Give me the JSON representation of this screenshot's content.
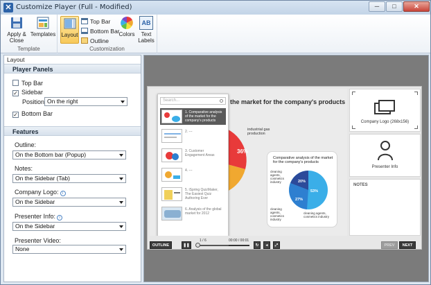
{
  "window": {
    "title": "Customize Player (Full - Modified)",
    "minimize": "─",
    "maximize": "□",
    "close": "✕"
  },
  "ribbon": {
    "template_group": {
      "label": "Template",
      "apply_close": "Apply & Close",
      "templates": "Templates"
    },
    "customization_group": {
      "label": "Customization",
      "layout": "Layout",
      "top_bar": "Top Bar",
      "bottom_bar": "Bottom Bar",
      "outline": "Outline",
      "colors": "Colors",
      "text_labels": "Text Labels",
      "text_labels_icon": "AB"
    }
  },
  "left_panel": {
    "header": "Layout",
    "player_panels": {
      "title": "Player Panels",
      "top_bar": {
        "label": "Top Bar",
        "checked": false
      },
      "sidebar": {
        "label": "Sidebar",
        "checked": true
      },
      "position_label": "Position:",
      "position_value": "On the right",
      "bottom_bar": {
        "label": "Bottom Bar",
        "checked": true
      }
    },
    "features": {
      "title": "Features",
      "outline_label": "Outline:",
      "outline_value": "On the Bottom bar (Popup)",
      "notes_label": "Notes:",
      "notes_value": "On the Sidebar (Tab)",
      "company_logo_label": "Company Logo:",
      "company_logo_value": "On the Sidebar",
      "presenter_info_label": "Presenter Info:",
      "presenter_info_value": "On the Sidebar",
      "presenter_video_label": "Presenter Video:",
      "presenter_video_value": "None"
    },
    "check_mark": "✓"
  },
  "preview": {
    "slide_title": "of the market for the company's products",
    "pie_label": "industrial gas production",
    "pie_pct": "36%",
    "inset_title": "Comparative analysis of the market for the company's products",
    "inset_pcts": [
      "20%",
      "27%",
      "53%"
    ],
    "inset_labels": [
      "cleaning agents, cosmetics industry",
      "cleaning agents, cosmetics industry",
      "cleaning agents, cosmetics industry"
    ],
    "outline": {
      "search_placeholder": "Search...",
      "items": [
        "1. Comparative analysis of the market for the company's products",
        "2. ---",
        "3. Customer Engagement Areas",
        "4. ---",
        "5. iSpring QuizMaker, The Easiest Quiz Authoring Ever",
        "6. Analysis of the global market for 2012"
      ]
    },
    "sidebar": {
      "logo_label": "Company Logo (268x156)",
      "presenter_label": "Presenter Info",
      "notes_label": "NOTES"
    },
    "controls": {
      "outline_btn": "OUTLINE",
      "slide_counter": "1 / 6",
      "time": "00:00 / 00:01",
      "prev": "PREV",
      "next": "NEXT"
    }
  },
  "colors": {
    "accent": "#f7c95a",
    "pie_red": "#e83a3a",
    "pie_orange": "#f0a830",
    "inset_dark": "#2c4a9a",
    "inset_mid": "#2e7fd0",
    "inset_light": "#3aaee8"
  }
}
